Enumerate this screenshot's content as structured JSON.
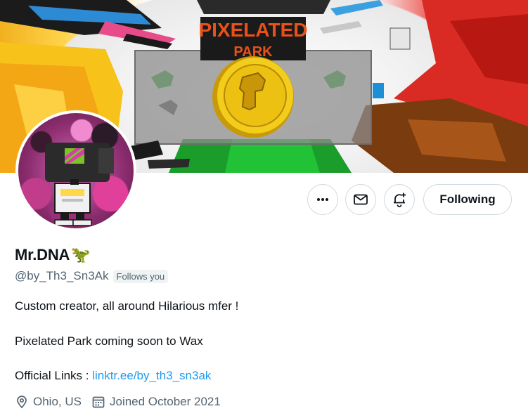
{
  "banner": {
    "title_line1": "PIXELATED",
    "title_line2": "PARK"
  },
  "actions": {
    "more_icon": "ellipsis-icon",
    "message_icon": "envelope-icon",
    "notify_icon": "bell-plus-icon",
    "follow_label": "Following"
  },
  "profile": {
    "display_name": "Mr.DNA",
    "name_emoji": "🦖",
    "handle": "@by_Th3_Sn3Ak",
    "follows_you": "Follows you",
    "bio_line1": "Custom creator, all around Hilarious mfer !",
    "bio_line2": "Pixelated Park  coming soon to Wax",
    "bio_line3_prefix": "Official Links : ",
    "bio_link": "linktr.ee/by_th3_sn3ak",
    "location": "Ohio, US",
    "joined": "Joined October 2021"
  },
  "colors": {
    "link": "#1d9bf0",
    "secondary_text": "#536471",
    "border": "#cfd9de"
  }
}
